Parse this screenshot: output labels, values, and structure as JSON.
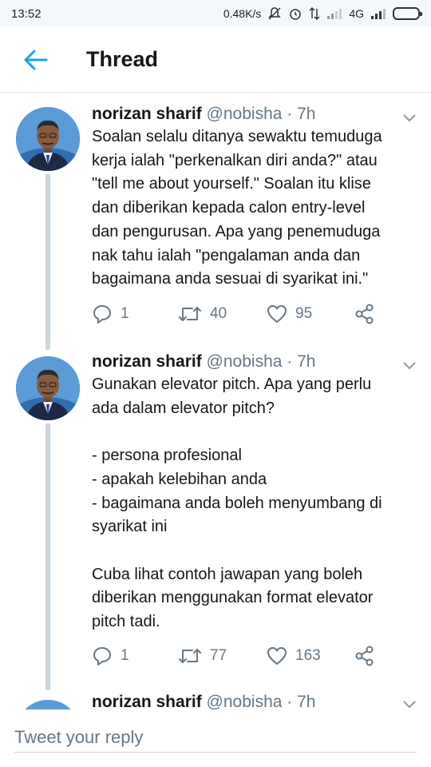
{
  "status_bar": {
    "time": "13:52",
    "network_speed": "0.48K/s",
    "network_type": "4G"
  },
  "header": {
    "title": "Thread"
  },
  "tweets": [
    {
      "name": "norizan sharif",
      "handle": "@nobisha",
      "separator": "·",
      "time": "7h",
      "lines": [
        "Soalan selalu ditanya sewaktu temuduga",
        "kerja ialah \"perkenalkan diri anda?\" atau",
        "\"tell me about yourself.\" Soalan itu klise",
        "dan diberikan kepada calon entry-level",
        "dan pengurusan. Apa yang penemuduga",
        "nak tahu ialah \"pengalaman anda dan",
        "bagaimana anda sesuai di syarikat ini.\""
      ],
      "replies": "1",
      "retweets": "40",
      "likes": "95"
    },
    {
      "name": "norizan sharif",
      "handle": "@nobisha",
      "separator": "·",
      "time": "7h",
      "lines": [
        "Gunakan elevator pitch. Apa yang perlu",
        "ada dalam elevator pitch?",
        "- persona profesional",
        "- apakah kelebihan anda",
        "- bagaimana anda boleh menyumbang di",
        "syarikat ini",
        "Cuba lihat contoh jawapan yang boleh",
        "diberikan menggunakan format elevator",
        "pitch tadi."
      ],
      "replies": "1",
      "retweets": "77",
      "likes": "163"
    },
    {
      "name": "norizan sharif",
      "handle": "@nobisha",
      "separator": "·",
      "time": "7h"
    }
  ],
  "reply": {
    "placeholder": "Tweet your reply"
  },
  "colors": {
    "accent": "#1da1f2",
    "text_primary": "#14171a",
    "text_secondary": "#657786",
    "thread_line": "#ccd6dd"
  },
  "icons": {
    "back": "arrow-left-icon",
    "caret": "chevron-down-icon",
    "reply": "speech-bubble-icon",
    "retweet": "retweet-icon",
    "like": "heart-icon",
    "share": "share-icon"
  }
}
